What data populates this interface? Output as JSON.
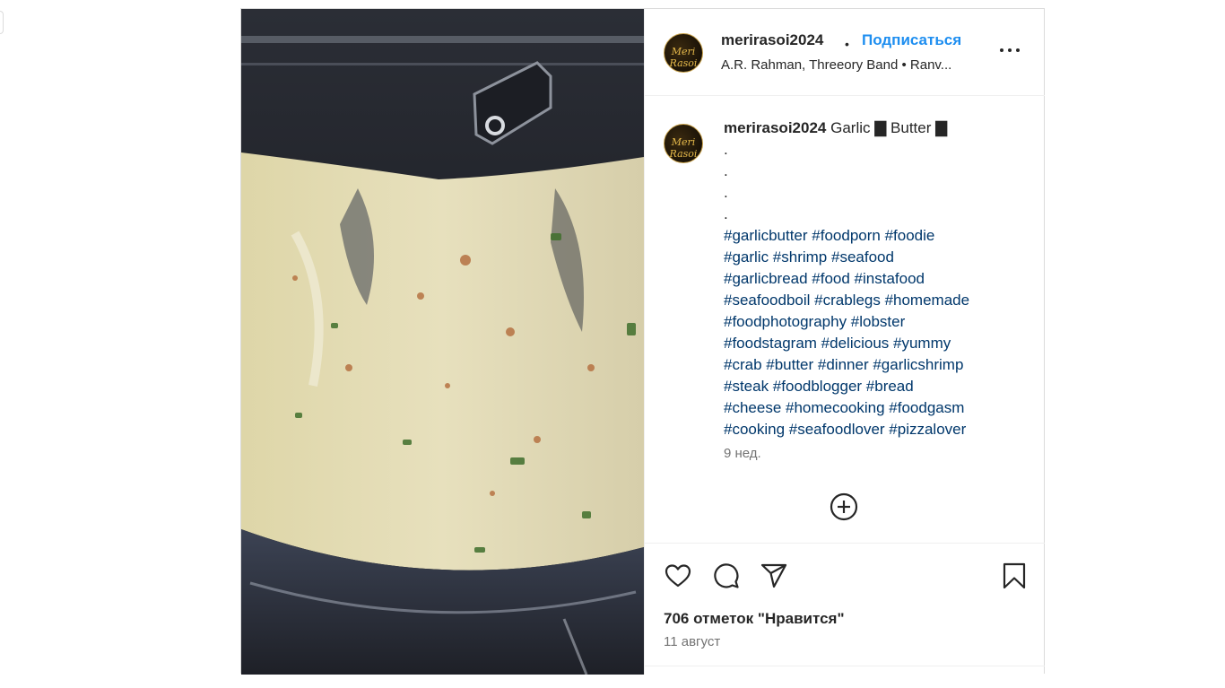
{
  "account": {
    "username": "merirasoi2024",
    "follow_label": "Подписаться",
    "separator": "•",
    "audio": "A.R. Rahman, Threeory Band • Ranv..."
  },
  "avatar_logo_text": "Meri Rasoi",
  "caption": {
    "username": "merirasoi2024",
    "text": "Garlic ▇ Butter ▇",
    "dots": [
      ".",
      ".",
      ".",
      "."
    ],
    "hashtag_lines": [
      "#garlicbutter #foodporn #foodie",
      "#garlic #shrimp #seafood",
      "#garlicbread #food #instafood",
      "#seafoodboil #crablegs #homemade",
      "#foodphotography #lobster",
      "#foodstagram #delicious #yummy",
      "#crab #butter #dinner #garlicshrimp",
      "#steak #foodblogger #bread",
      "#cheese #homecooking #foodgasm",
      "#cooking #seafoodlover #pizzalover"
    ],
    "time_ago": "9 нед."
  },
  "actions": {
    "icons": [
      "heart-icon",
      "comment-icon",
      "share-icon",
      "bookmark-icon",
      "add-comment-icon",
      "more-icon"
    ]
  },
  "likes_text": "706 отметок \"Нравится\"",
  "post_date": "11 август",
  "colors": {
    "accent": "#1e8ef0",
    "hashtag": "#00376b",
    "muted": "#737373",
    "border": "#dbdbdb"
  }
}
